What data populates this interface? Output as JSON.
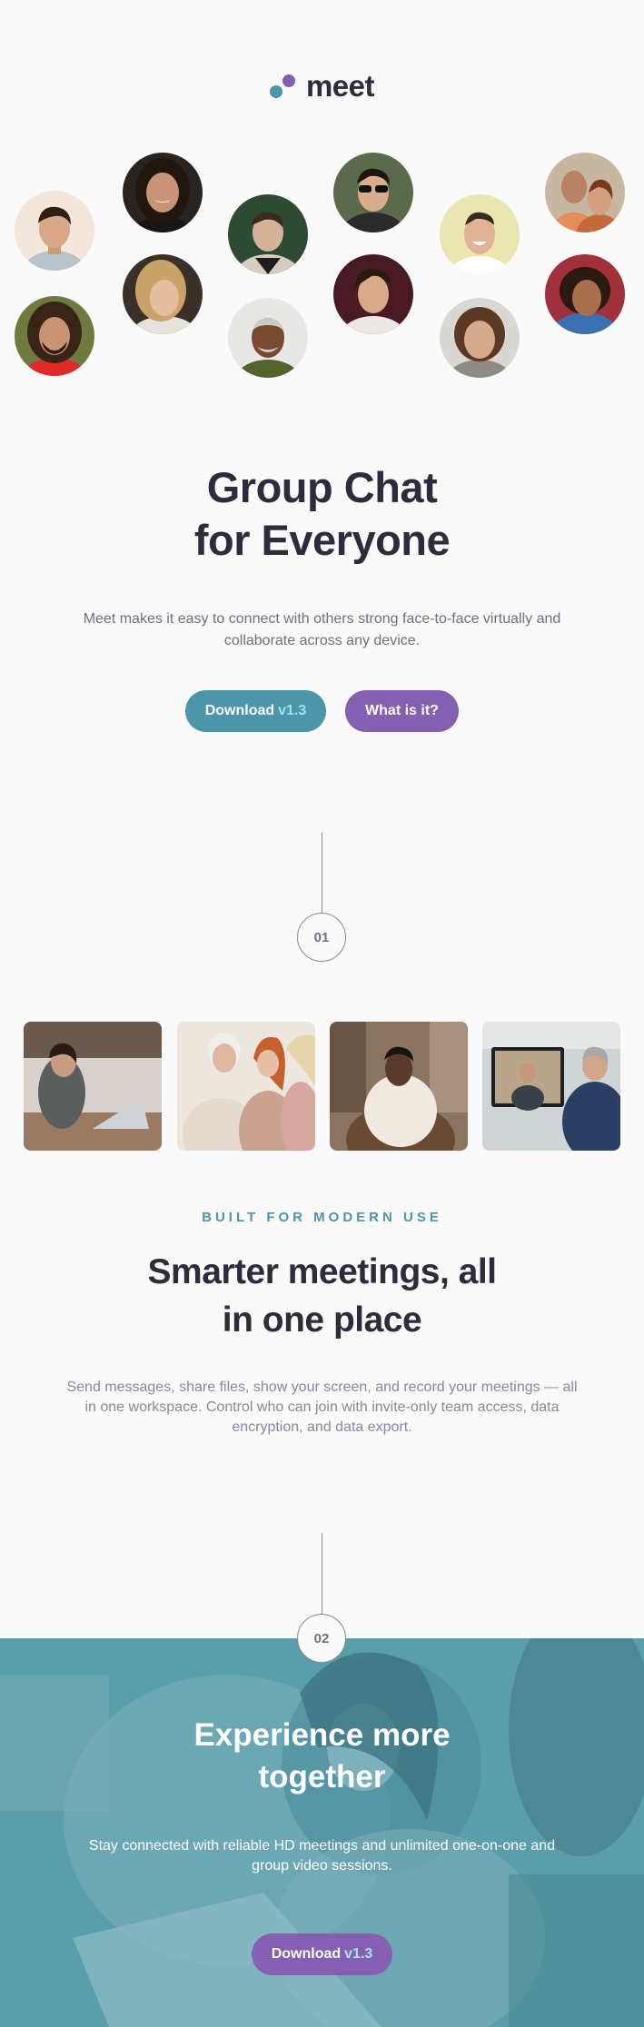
{
  "brand": {
    "name": "meet",
    "colors": {
      "teal": "#4d96a9",
      "purple": "#855fb1",
      "dark": "#2c2c3d",
      "gray": "#6d7080"
    }
  },
  "hero": {
    "title_line1": "Group Chat",
    "title_line2": "for Everyone",
    "description": "Meet makes it easy to connect with others strong face-to-face virtually and collaborate across any device.",
    "primary_button": {
      "label": "Download",
      "version": "v1.3"
    },
    "secondary_button": {
      "label": "What is it?"
    }
  },
  "step1": {
    "number": "01"
  },
  "features": {
    "eyebrow": "BUILT FOR MODERN USE",
    "title_line1": "Smarter meetings, all",
    "title_line2": "in one place",
    "description": "Send messages, share files, show your screen, and record your meetings — all in one workspace. Control who can join with invite-only team access, data encryption, and data export."
  },
  "step2": {
    "number": "02"
  },
  "banner": {
    "title_line1": "Experience more",
    "title_line2": "together",
    "description": "Stay connected with reliable HD meetings and unlimited one-on-one and group video sessions.",
    "button": {
      "label": "Download",
      "version": "v1.3"
    }
  }
}
